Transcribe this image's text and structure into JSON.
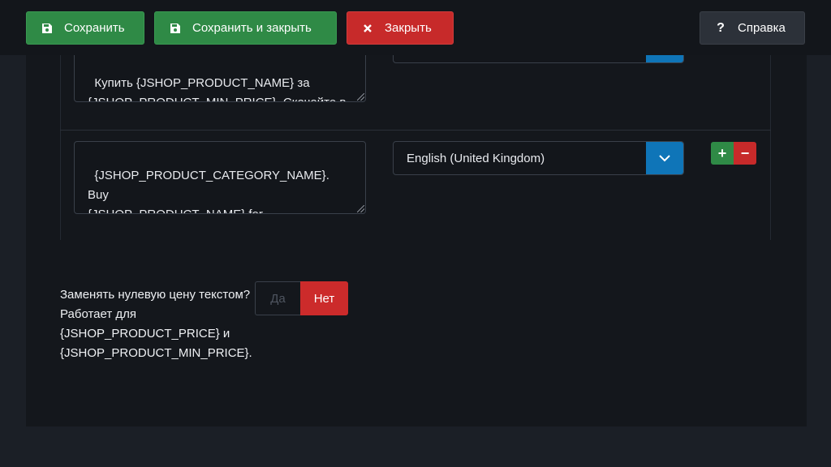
{
  "toolbar": {
    "save_label": "Сохранить",
    "save_close_label": "Сохранить и закрыть",
    "close_label": "Закрыть",
    "help_label": "Справка"
  },
  "rows": [
    {
      "text": "Купить {JSHOP_PRODUCT_NAME} за\n{JSHOP_PRODUCT_MIN_PRICE}. Скачайте в",
      "language": ""
    },
    {
      "text": "{JSHOP_PRODUCT_CATEGORY_NAME}. Buy\n{JSHOP_PRODUCT_NAME} for\n{JSHOP_PRODUCT_MIN_PRICE}. Download it",
      "language": "English (United Kingdom)"
    }
  ],
  "row_controls": {
    "add": "+",
    "remove": "−"
  },
  "zero_price": {
    "label": "Заменять нулевую цену текстом? Работает для {JSHOP_PRODUCT_PRICE} и {JSHOP_PRODUCT_MIN_PRICE}.",
    "yes": "Да",
    "no": "Нет",
    "selected": "no"
  },
  "colors": {
    "save": "#2f8a46",
    "close": "#c72a2a",
    "select_caret": "#0f75b8"
  }
}
